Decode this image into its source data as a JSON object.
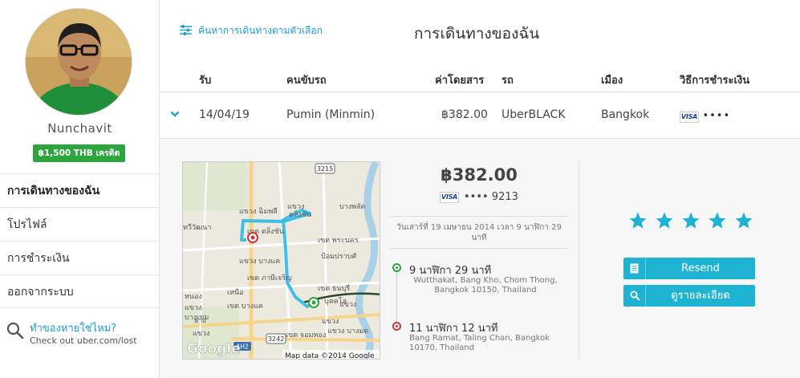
{
  "sidebar": {
    "username": "Nunchavit",
    "credit": "฿1,500 THB เครดิต",
    "nav": [
      {
        "label": "การเดินทางของฉัน"
      },
      {
        "label": "โปรไฟล์"
      },
      {
        "label": "การชำระเงิน"
      },
      {
        "label": "ออกจากระบบ"
      }
    ],
    "lost": {
      "link": "ทำของหายใช่ไหม?",
      "sub": "Check out uber.com/lost"
    }
  },
  "header": {
    "filter_label": "ค้นหาการเดินทางตามตัวเลือก",
    "title": "การเดินทางของฉัน"
  },
  "table": {
    "columns": [
      "รับ",
      "คนขับรถ",
      "ค่าโดยสาร",
      "รถ",
      "เมือง",
      "วิธีการชำระเงิน"
    ],
    "row": {
      "date": "14/04/19",
      "driver": "Pumin (Minmin)",
      "fare": "฿382.00",
      "car": "UberBLACK",
      "city": "Bangkok",
      "card_brand": "VISA",
      "card_dots": "••••"
    }
  },
  "detail": {
    "fare": "฿382.00",
    "card_brand": "VISA",
    "card_last": "•••• 9213",
    "trip_date": "วันเสาร์ที่ 19 เมษายน 2014 เวลา 9 นาฬิกา 29 นาที",
    "pickup": {
      "time": "9 นาฬิกา 29 นาที",
      "address": "Wutthakat, Bang Kho, Chom Thong, Bangkok 10150, Thailand"
    },
    "dropoff": {
      "time": "11 นาฬิกา 12 นาที",
      "address": "Bang Ramat, Taling Chan, Bangkok 10170, Thailand"
    },
    "rating": 5,
    "buttons": {
      "resend": "Resend",
      "details": "ดูรายละเอียด"
    },
    "map": {
      "attribution": "Map data ©2014 Google",
      "google": "Google",
      "labels": {
        "l1": "แขวง ฉิมพลี",
        "l2": "แขวง",
        "l3": "ตลิ่งชัน",
        "l4": "บางพลัด",
        "l5": "ทวีวัฒนา",
        "l6": "เขต ตลิ่งชัน",
        "l7": "เขต พระนคร",
        "l8": "ป้อมปราบศั",
        "l9": "แขวง บางแค",
        "l10": "เขต ภาษีเจริญ",
        "l11": "เขต ธนบุรี",
        "l12": "หนอง",
        "l13": "เหนือ",
        "l14": "เขต บางแค",
        "l15": "แขวง",
        "l16": "บุคคโล",
        "l17": "แขวง",
        "l18": "เขต จอมทอง",
        "l19": "บางเขม",
        "l20": "แขวง บางมด",
        "l21": "แขวง",
        "l22": "แขวง",
        "l23": "ยาง",
        "r1": "3215",
        "r2": "3242",
        "r3": "AH2"
      }
    }
  },
  "colors": {
    "accent": "#1a9fd1",
    "button": "#1fb3d3",
    "credit": "#2ea43f",
    "route": "#3fbfe6",
    "pickup": "#2ea43f",
    "dropoff": "#d0343a"
  }
}
